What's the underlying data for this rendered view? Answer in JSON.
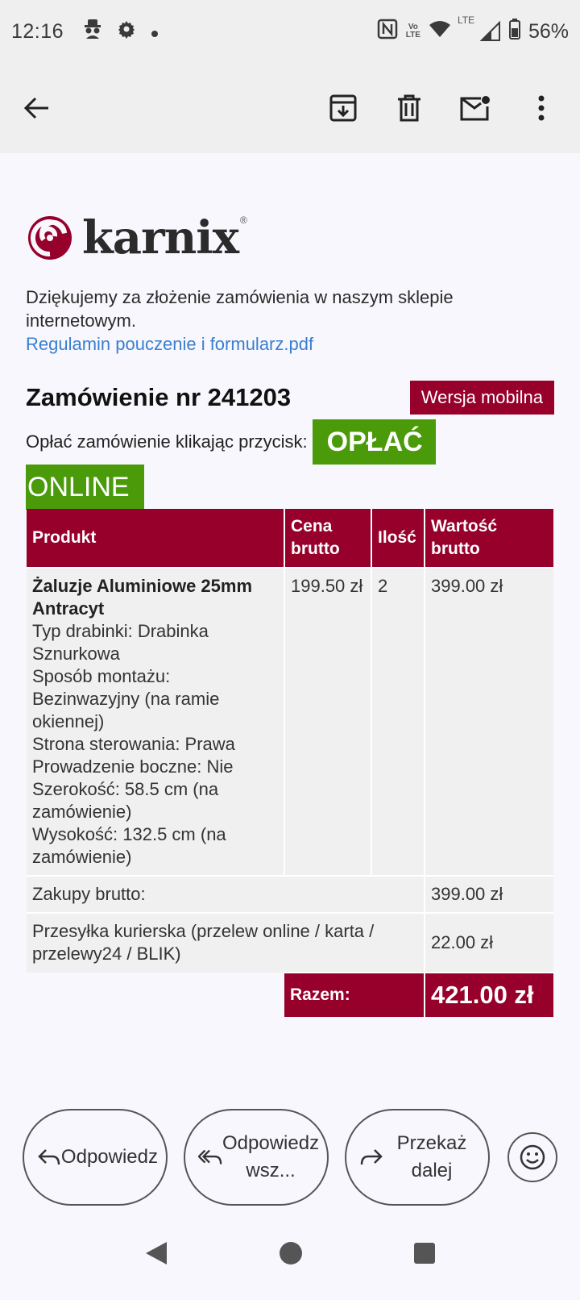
{
  "status": {
    "time": "12:16",
    "lte_top": "Vo",
    "lte_bottom": "LTE",
    "lte_signal": "LTE",
    "battery": "56%"
  },
  "email": {
    "logo_text": "karnix",
    "logo_reg": "®",
    "intro_text": "Dziękujemy za złożenie zamówienia w naszym sklepie internetowym.",
    "attachment_link": "Regulamin pouczenie i formularz.pdf",
    "order_title": "Zamówienie nr 241203",
    "mobile_button": "Wersja mobilna",
    "pay_prompt": "Opłać zamówienie klikając przycisk:",
    "pay_button_line1": "OPŁAĆ",
    "pay_button_line2": "ONLINE",
    "table": {
      "headers": [
        "Produkt",
        "Cena brutto",
        "Ilość",
        "Wartość brutto"
      ],
      "product": {
        "name": "Żaluzje Aluminiowe 25mm Antracyt",
        "details": [
          "Typ drabinki: Drabinka Sznurkowa",
          "Sposób montażu: Bezinwazyjny (na ramie okiennej)",
          "Strona sterowania: Prawa",
          "Prowadzenie boczne: Nie",
          "Szerokość: 58.5 cm (na zamówienie)",
          "Wysokość: 132.5 cm (na zamówienie)"
        ],
        "price": "199.50 zł",
        "qty": "2",
        "value": "399.00 zł"
      },
      "subtotal_label": "Zakupy brutto:",
      "subtotal_value": "399.00 zł",
      "shipping_label": "Przesyłka kurierska (przelew online / karta / przelewy24 / BLIK)",
      "shipping_value": "22.00 zł",
      "total_label": "Razem:",
      "total_value": "421.00 zł"
    }
  },
  "reply_bar": {
    "reply": "Odpowiedz",
    "reply_all": "Odpowiedz wsz...",
    "forward": "Przekaż dalej"
  },
  "colors": {
    "brand": "#96002a",
    "pay": "#4a9a0a",
    "link": "#3a7fd1"
  }
}
